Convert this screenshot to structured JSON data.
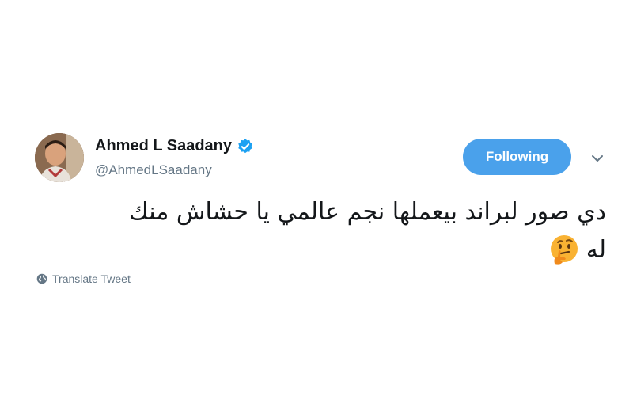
{
  "user": {
    "display_name": "Ahmed L Saadany",
    "handle": "@AhmedLSaadany",
    "verified": true
  },
  "follow_button": {
    "label": "Following"
  },
  "tweet": {
    "text_line1": "دي صور لبراند بيعملها نجم عالمي يا حشاش منك",
    "text_line2": "له",
    "emoji_icon": "thinking-face-icon"
  },
  "translate": {
    "label": "Translate Tweet",
    "icon": "globe-icon"
  },
  "colors": {
    "accent": "#4aa1eb",
    "secondary_text": "#657786",
    "primary_text": "#14171a"
  }
}
